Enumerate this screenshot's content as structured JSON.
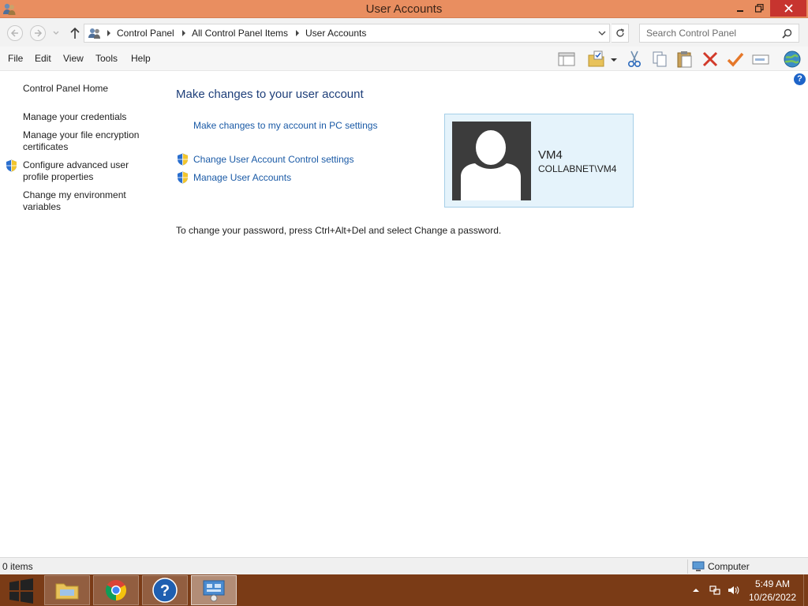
{
  "window": {
    "title": "User Accounts"
  },
  "address": {
    "crumbs": [
      "Control Panel",
      "All Control Panel Items",
      "User Accounts"
    ],
    "search_placeholder": "Search Control Panel"
  },
  "menu": {
    "items": [
      "File",
      "Edit",
      "View",
      "Tools",
      "Help"
    ]
  },
  "sidebar": {
    "home": "Control Panel Home",
    "links": [
      "Manage your credentials",
      "Manage your file encryption certificates",
      "Configure advanced user profile properties",
      "Change my environment variables"
    ]
  },
  "main": {
    "title": "Make changes to your user account",
    "pc_settings_link": "Make changes to my account in PC settings",
    "uac_link": "Change User Account Control settings",
    "manage_link": "Manage User Accounts",
    "password_text": "To change your password, press Ctrl+Alt+Del and select Change a password."
  },
  "account": {
    "name": "VM4",
    "domain": "COLLABNET\\VM4"
  },
  "status": {
    "items": "0 items",
    "zone": "Computer"
  },
  "taskbar": {
    "time": "5:49 AM",
    "date": "10/26/2022"
  },
  "colors": {
    "titlebar": "#e98e60",
    "close": "#c7342f",
    "taskbar": "#7a3b16",
    "link": "#1a5aa6",
    "card": "#e5f3fb"
  }
}
